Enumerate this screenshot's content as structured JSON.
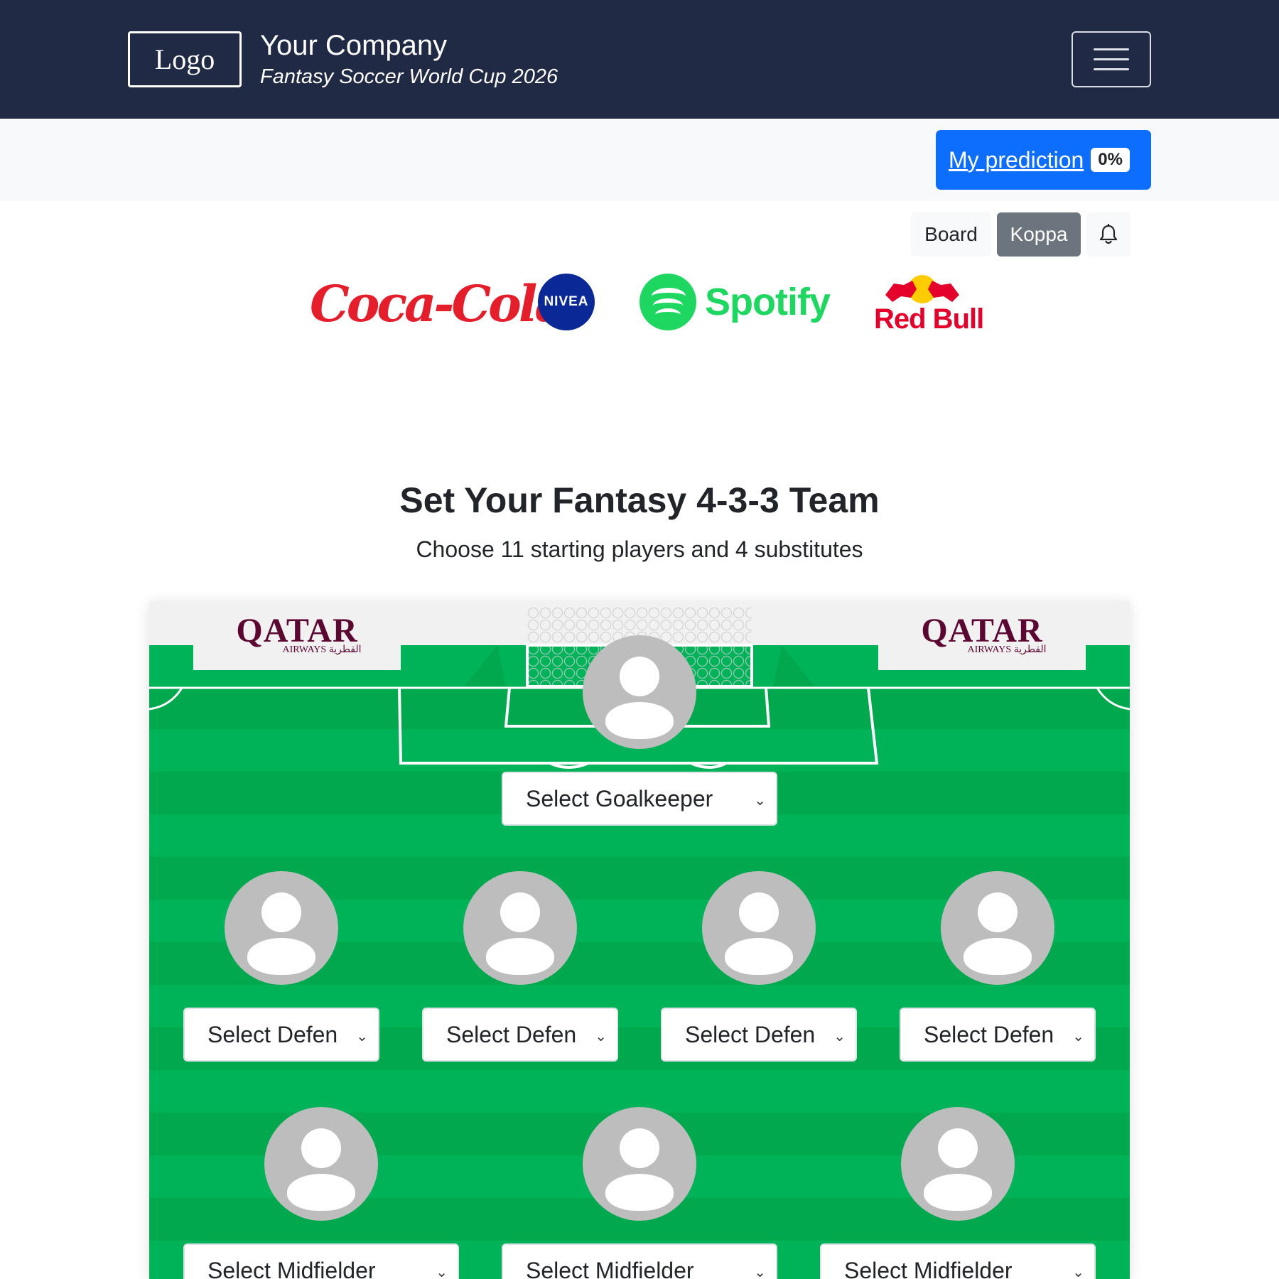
{
  "header": {
    "logo": "Logo",
    "company_name": "Your Company",
    "subtitle": "Fantasy Soccer World Cup 2026",
    "menu_icon": "hamburger-menu-icon",
    "colors": {
      "background": "#212a45",
      "text": "#ffffff"
    }
  },
  "prediction": {
    "label": "My prediction ",
    "badge": "0%",
    "progress_percent": 0,
    "color": "#0d6efd"
  },
  "pills": {
    "board": "Board",
    "koppa": "Koppa",
    "bell_icon": "bell-icon"
  },
  "sponsors": {
    "coca_cola": "Coca-Cola",
    "nivea": "NIVEA",
    "spotify": "Spotify",
    "redbull": "Red Bull"
  },
  "main": {
    "title": "Set Your Fantasy 4-3-3 Team",
    "subtitle": "Choose 11 starting players and 4 substitutes"
  },
  "pitch": {
    "ads": {
      "left": "QATAR",
      "left_sub": "AIRWAYS القطرية",
      "right": "QATAR",
      "right_sub": "AIRWAYS القطرية"
    },
    "goalkeeper": {
      "placeholder": "Select Goalkeeper"
    },
    "defenders": [
      {
        "placeholder": "Select Defen"
      },
      {
        "placeholder": "Select Defen"
      },
      {
        "placeholder": "Select Defen"
      },
      {
        "placeholder": "Select Defen"
      }
    ],
    "midfielders": [
      {
        "placeholder": "Select Midfielder"
      },
      {
        "placeholder": "Select Midfielder"
      },
      {
        "placeholder": "Select Midfielder"
      }
    ],
    "colors": {
      "grass_dark": "#02a84d",
      "grass_light": "#00b358",
      "avatar": "#bdbdbd",
      "qatar": "#5c0632"
    }
  }
}
